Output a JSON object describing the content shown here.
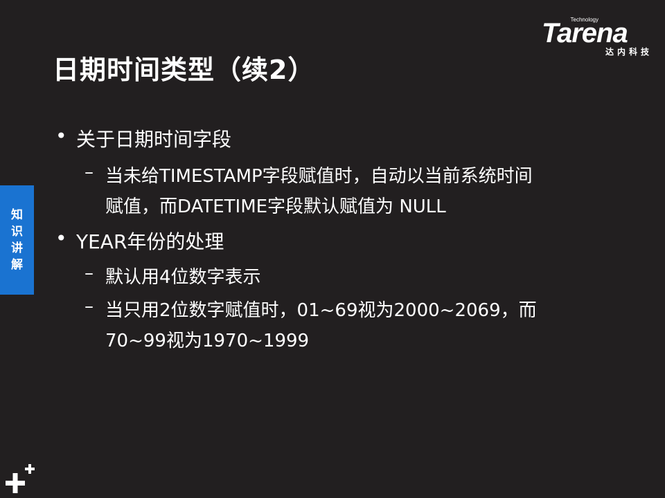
{
  "slide": {
    "title": "日期时间类型（续2）",
    "logo": {
      "technology": "Technology",
      "wordmark": "Tarena",
      "chinese": "达内科技"
    },
    "side_tab": "知识讲解",
    "content": {
      "bullet1": "关于日期时间字段",
      "sub1_line1": "当未给TIMESTAMP字段赋值时，自动以当前系统时间",
      "sub1_line2": "赋值，而DATETIME字段默认赋值为  NULL",
      "bullet2": "YEAR年份的处理",
      "sub2": "默认用4位数字表示",
      "sub3_line1": "当只用2位数字赋值时，01~69视为2000~2069，而",
      "sub3_line2": "70~99视为1970~1999"
    },
    "markers": {
      "bullet": "•",
      "dash": "–"
    },
    "colors": {
      "background": "#221f20",
      "accent_tab": "#1a73d1",
      "text": "#ffffff"
    }
  }
}
